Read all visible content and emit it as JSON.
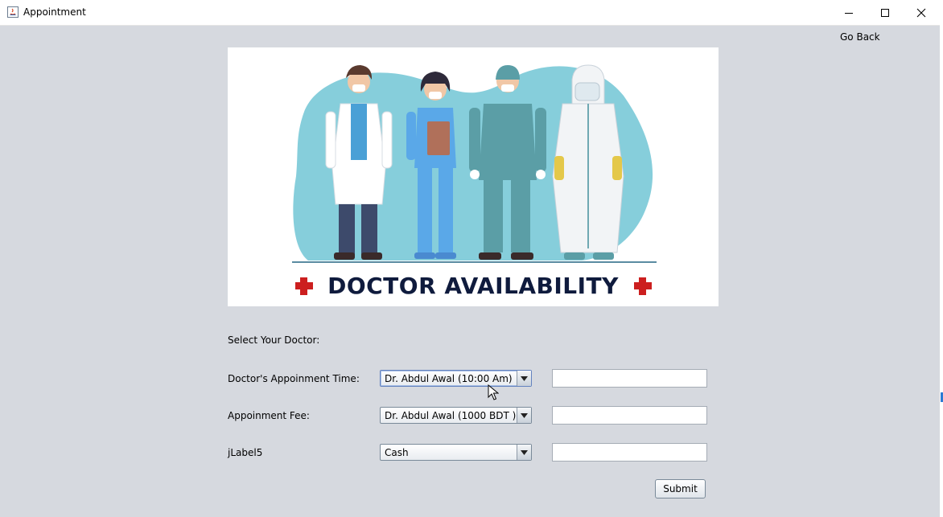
{
  "window": {
    "title": "Appointment",
    "minimize_label": "",
    "maximize_label": "",
    "close_label": ""
  },
  "nav": {
    "go_back": "Go Back"
  },
  "banner": {
    "title": "DOCTOR AVAILABILITY",
    "accent_color": "#cc1f1f",
    "title_color": "#0f1b3d",
    "blob_color": "#86cedb"
  },
  "form": {
    "select_doctor_label": "Select Your Doctor:",
    "rows": [
      {
        "label": "Doctor's Appoinment Time:",
        "selected": "Dr. Abdul Awal (10:00 Am)",
        "text_value": ""
      },
      {
        "label": "Appoinment Fee:",
        "selected": "Dr. Abdul Awal (1000 BDT )",
        "text_value": ""
      },
      {
        "label": "jLabel5",
        "selected": "Cash",
        "text_value": ""
      }
    ],
    "submit_label": "Submit"
  }
}
